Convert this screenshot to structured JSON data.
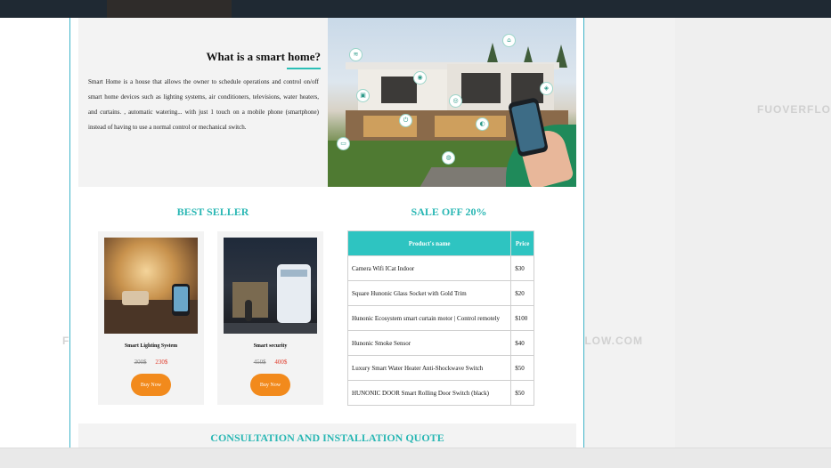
{
  "hero": {
    "title": "What is a smart home?",
    "body": "Smart Home is a house that allows the owner to schedule operations and control on/off smart home devices such as lighting systems, air conditioners, televisions, water heaters, and curtains. , automatic watering... with just 1 touch on a mobile phone (smartphone) instead of having to use a normal control or mechanical switch."
  },
  "best_seller": {
    "title": "BEST SELLER",
    "products": [
      {
        "name": "Smart Lighting System",
        "old_price": "300$",
        "new_price": "230$",
        "button": "Buy Now"
      },
      {
        "name": "Smart security",
        "old_price": "450$",
        "new_price": "400$",
        "button": "Buy Now"
      }
    ]
  },
  "sale": {
    "title": "SALE OFF 20%",
    "columns": [
      "Product's name",
      "Price"
    ],
    "rows": [
      {
        "name": "Camera Wifi ICat Indoor",
        "price": "$30"
      },
      {
        "name": "Square Hunonic Glass Socket with Gold Trim",
        "price": "$20"
      },
      {
        "name": "Hunonic Ecosystem smart curtain motor | Control remotely",
        "price": "$100"
      },
      {
        "name": "Hunonic Smoke Sensor",
        "price": "$40"
      },
      {
        "name": "Luxury Smart Water Heater Anti-Shockwave Switch",
        "price": "$50"
      },
      {
        "name": "HUNONIC DOOR Smart Rolling Door Switch (black)",
        "price": "$50"
      }
    ]
  },
  "consultation": {
    "title": "CONSULTATION AND INSTALLATION QUOTE"
  },
  "watermarks": {
    "brand": "FUOVERFLOW",
    "site": "FUOVERFLOW.COM"
  },
  "colors": {
    "accent": "#2ec4c1",
    "buy_button": "#f28a1c",
    "sale_price": "#e03b2b"
  }
}
